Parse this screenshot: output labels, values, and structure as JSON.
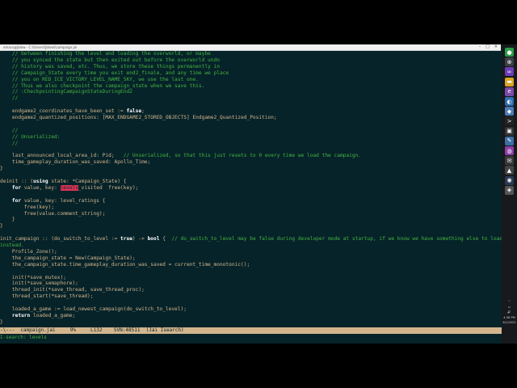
{
  "window": {
    "title": "emacs@jblow - C:\\\\Users\\\\jblow\\\\campaign.jai",
    "minimize": "–",
    "maximize": "□",
    "close": "✕"
  },
  "code_lines": [
    [
      {
        "t": "    // between finishing the level and loading the overworld, or maybe",
        "c": "cmt"
      }
    ],
    [
      {
        "t": "    // you synced the state but then exited out before the overworld undo",
        "c": "cmt"
      }
    ],
    [
      {
        "t": "    // history was saved, etc. Thus, we store these things permanently in",
        "c": "cmt"
      }
    ],
    [
      {
        "t": "    // Campaign_State every time you exit end2_finale, and any time we place",
        "c": "cmt"
      }
    ],
    [
      {
        "t": "    // you on RED_ICE_VICTORY_LEVEL_NAME_SKY, we use the last one.",
        "c": "cmt"
      }
    ],
    [
      {
        "t": "    // Thus we also checkpoint the campaign_state when we save this.",
        "c": "cmt"
      }
    ],
    [
      {
        "t": "    // :CheckpointingCampaignStateDuringEnd2",
        "c": "cmt"
      }
    ],
    [
      {
        "t": "    //",
        "c": "cmt"
      }
    ],
    [],
    [
      {
        "t": "    endgame2_coordinates_have_been_set := ",
        "c": "lit"
      },
      {
        "t": "false",
        "c": "kw"
      },
      {
        "t": ";",
        "c": "lit"
      }
    ],
    [
      {
        "t": "    endgame2_quantized_positions: [MAX_ENDGAME2_STORED_OBJECTS] Endgame2_Quantized_Position;",
        "c": "lit"
      }
    ],
    [],
    [
      {
        "t": "    //",
        "c": "cmt"
      }
    ],
    [
      {
        "t": "    // Unserialized:",
        "c": "cmt"
      }
    ],
    [
      {
        "t": "    //",
        "c": "cmt"
      }
    ],
    [],
    [
      {
        "t": "    last_announced_local_area_id: Pid;   ",
        "c": "lit"
      },
      {
        "t": "// Unserialized, so that this just resets to 0 every time we load the campaign.",
        "c": "cmt"
      }
    ],
    [
      {
        "t": "    time_gameplay_duration_was_saved: Apollo_Time;",
        "c": "lit"
      }
    ],
    [
      {
        "t": "}",
        "c": "lit"
      }
    ],
    [],
    [
      {
        "t": "deinit :: (",
        "c": "lit"
      },
      {
        "t": "using",
        "c": "kw"
      },
      {
        "t": " state: *Campaign_State) {",
        "c": "lit"
      }
    ],
    [
      {
        "t": "    ",
        "c": "lit"
      },
      {
        "t": "for",
        "c": "kw"
      },
      {
        "t": " value, key: ",
        "c": "lit"
      },
      {
        "t": "levels",
        "c": "hl"
      },
      {
        "t": "_visited  free(key);",
        "c": "lit"
      }
    ],
    [],
    [
      {
        "t": "    ",
        "c": "lit"
      },
      {
        "t": "for",
        "c": "kw"
      },
      {
        "t": " value, key: level_ratings {",
        "c": "lit"
      }
    ],
    [
      {
        "t": "        free(key);",
        "c": "lit"
      }
    ],
    [
      {
        "t": "        free(value.comment_string);",
        "c": "lit"
      }
    ],
    [
      {
        "t": "    }",
        "c": "lit"
      }
    ],
    [
      {
        "t": "}",
        "c": "lit"
      }
    ],
    [],
    [
      {
        "t": "init_campaign :: (do_switch_to_level := ",
        "c": "lit"
      },
      {
        "t": "true",
        "c": "kw"
      },
      {
        "t": ") -> ",
        "c": "lit"
      },
      {
        "t": "bool",
        "c": "kw"
      },
      {
        "t": " {  ",
        "c": "lit"
      },
      {
        "t": "// do_switch_to_level may be false during developer mode at startup, if we know we have something else to load",
        "c": "cmt"
      },
      {
        "t": " \\",
        "c": "lit"
      }
    ],
    [
      {
        "t": "instead.",
        "c": "cmt"
      }
    ],
    [
      {
        "t": "    Profile_Zone();",
        "c": "lit"
      }
    ],
    [
      {
        "t": "    the_campaign_state = New(Campaign_State);",
        "c": "lit"
      }
    ],
    [
      {
        "t": "    the_campaign_state.time_gameplay_duration_was_saved = current_time_monotonic();",
        "c": "lit"
      }
    ],
    [],
    [
      {
        "t": "    init(*save_mutex);",
        "c": "lit"
      }
    ],
    [
      {
        "t": "    init(*save_semaphore);",
        "c": "lit"
      }
    ],
    [
      {
        "t": "    thread_init(*save_thread, save_thread_proc);",
        "c": "lit"
      }
    ],
    [
      {
        "t": "    thread_start(*save_thread);",
        "c": "lit"
      }
    ],
    [],
    [
      {
        "t": "    loaded_a_game := load_newest_campaign(do_switch_to_level);",
        "c": "lit"
      }
    ],
    [
      {
        "t": "    ",
        "c": "lit"
      },
      {
        "t": "return",
        "c": "kw"
      },
      {
        "t": " loaded_a_game;",
        "c": "lit"
      }
    ],
    [
      {
        "t": "}",
        "c": "lit"
      }
    ]
  ],
  "modeline": {
    "status": "-\\---",
    "buffer": "campaign.jai",
    "percent": "9%",
    "line": "L132",
    "svn": "SVN:48511",
    "mode": "(Jai Isearch)"
  },
  "minibuffer": {
    "label": "I-search:",
    "query": "levels"
  },
  "taskbar": {
    "icons": [
      {
        "name": "chrome-icon",
        "glyph": "●",
        "color": "#2a9d4a"
      },
      {
        "name": "pin-icon",
        "glyph": "⊕",
        "color": "#3a3f46"
      },
      {
        "name": "visual-studio-icon",
        "glyph": "∞",
        "color": "#6a3db5"
      },
      {
        "name": "folder-icon",
        "glyph": "▬",
        "color": "#d9a521"
      },
      {
        "name": "emacs-icon",
        "glyph": "e",
        "color": "#7a4aa8"
      },
      {
        "name": "explorer-icon",
        "glyph": "◐",
        "color": "#2f6fb3"
      },
      {
        "name": "photo-icon",
        "glyph": "◆",
        "color": "#4a7ab8"
      },
      {
        "name": "terminal-icon",
        "glyph": ">",
        "color": "#222222"
      },
      {
        "name": "app-icon",
        "glyph": "▣",
        "color": "#333333"
      },
      {
        "name": "tool-icon",
        "glyph": "✎",
        "color": "#3b6ea5"
      },
      {
        "name": "app2-icon",
        "glyph": "◍",
        "color": "#8b3fa8"
      },
      {
        "name": "mail-icon",
        "glyph": "✉",
        "color": "#3a3a3a"
      },
      {
        "name": "game-icon",
        "glyph": "▲",
        "color": "#444444"
      },
      {
        "name": "steam-icon",
        "glyph": "◉",
        "color": "#2a3a55"
      },
      {
        "name": "shield-icon",
        "glyph": "◈",
        "color": "#555555"
      }
    ],
    "tray": [
      "^",
      "▭",
      "🔊",
      "4:36 PM",
      "6/1/2022"
    ]
  }
}
